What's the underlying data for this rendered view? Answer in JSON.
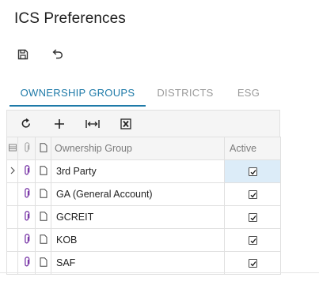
{
  "page": {
    "title": "ICS Preferences"
  },
  "tabs": [
    {
      "label": "OWNERSHIP GROUPS",
      "active": true
    },
    {
      "label": "DISTRICTS",
      "active": false
    },
    {
      "label": "ESG",
      "active": false
    }
  ],
  "grid": {
    "columns": {
      "group": "Ownership Group",
      "active": "Active"
    },
    "rows": [
      {
        "name": "3rd Party",
        "active": true,
        "selected": true
      },
      {
        "name": "GA (General Account)",
        "active": true,
        "selected": false
      },
      {
        "name": "GCREIT",
        "active": true,
        "selected": false
      },
      {
        "name": "KOB",
        "active": true,
        "selected": false
      },
      {
        "name": "SAF",
        "active": true,
        "selected": false
      }
    ]
  },
  "colors": {
    "accent": "#1e7aa8",
    "selected_cell": "#dcecf8",
    "paperclip": "#7b3aa8"
  },
  "icons": {
    "save": "save-icon",
    "undo": "undo-icon",
    "refresh": "refresh-icon",
    "add": "plus-icon",
    "fit": "fit-columns-icon",
    "excel": "excel-export-icon"
  }
}
